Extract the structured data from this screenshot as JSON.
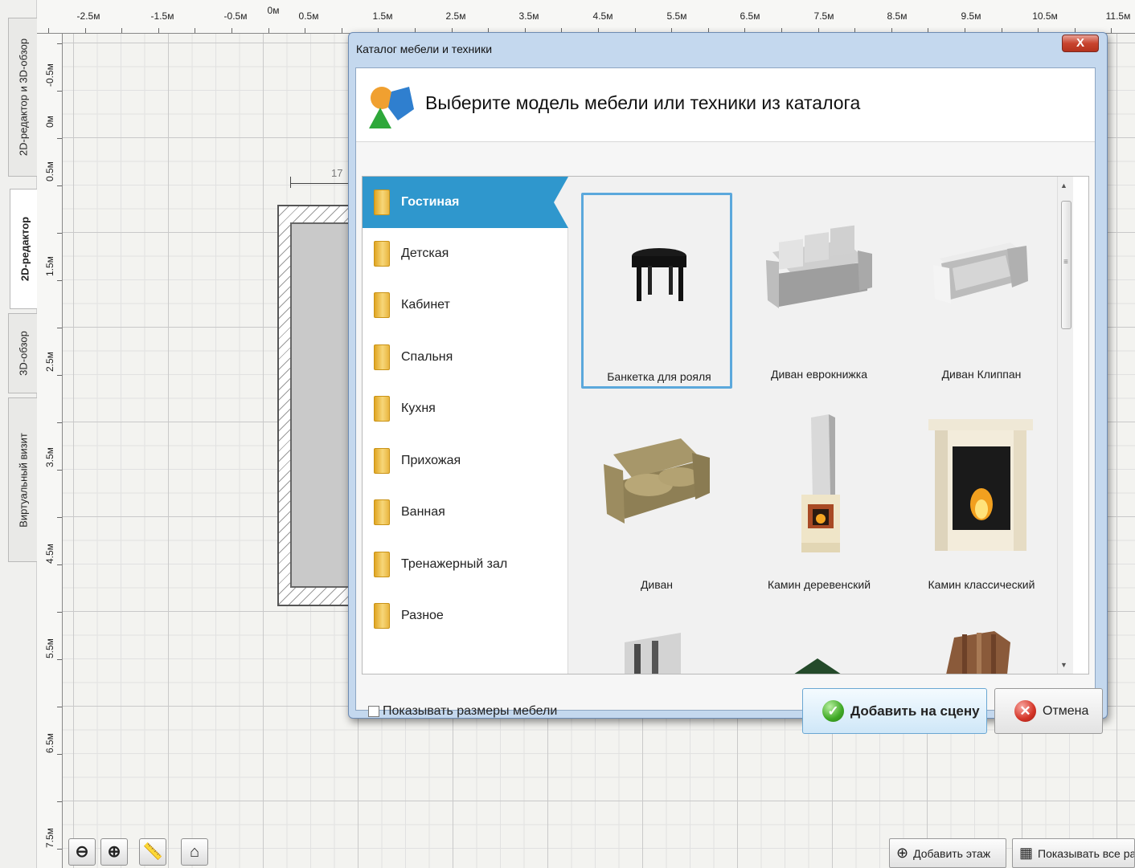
{
  "side_tabs": [
    {
      "label": "2D-редактор и 3D-обзор"
    },
    {
      "label": "2D-редактор"
    },
    {
      "label": "3D-обзор"
    },
    {
      "label": "Виртуальный визит"
    }
  ],
  "ruler": {
    "horizontal": [
      "-2.5м",
      "-1.5м",
      "-0.5м",
      "0м",
      "0.5м",
      "1.5м",
      "2.5м",
      "3.5м",
      "4.5м",
      "5.5м",
      "6.5м",
      "7.5м",
      "8.5м",
      "9.5м",
      "10.5м",
      "11.5м"
    ],
    "vertical": [
      "-0.5м",
      "0м",
      "0.5м",
      "1.5м",
      "2.5м",
      "3.5м",
      "4.5м",
      "5.5м",
      "6.5м",
      "7.5м"
    ]
  },
  "plan": {
    "dimension_text": "17"
  },
  "toolbar": {
    "zoom_out_icon": "zoom-out-icon",
    "zoom_in_icon": "zoom-in-icon",
    "ruler_icon": "ruler-icon",
    "home_icon": "home-icon",
    "add_floor": "Добавить этаж",
    "show_all_sizes": "Показывать все разм"
  },
  "dialog": {
    "title": "Каталог мебели и техники",
    "close_label": "X",
    "heading": "Выберите модель мебели или техники из каталога",
    "categories": [
      {
        "label": "Гостиная",
        "selected": true
      },
      {
        "label": "Детская"
      },
      {
        "label": "Кабинет"
      },
      {
        "label": "Спальня"
      },
      {
        "label": "Кухня"
      },
      {
        "label": "Прихожая"
      },
      {
        "label": "Ванная"
      },
      {
        "label": "Тренажерный зал"
      },
      {
        "label": "Разное"
      }
    ],
    "items": [
      {
        "label": "Банкетка для рояля",
        "selected": true
      },
      {
        "label": "Диван еврокнижка"
      },
      {
        "label": "Диван Клиппан"
      },
      {
        "label": "Диван"
      },
      {
        "label": "Камин деревенский"
      },
      {
        "label": "Камин классический"
      }
    ],
    "show_sizes_label": "Показывать размеры мебели",
    "add_button": "Добавить на сцену",
    "cancel_button": "Отмена"
  },
  "colors": {
    "accent": "#2f97cd",
    "dialog_frame": "#c4d8ee",
    "close_button": "#c8442f"
  }
}
